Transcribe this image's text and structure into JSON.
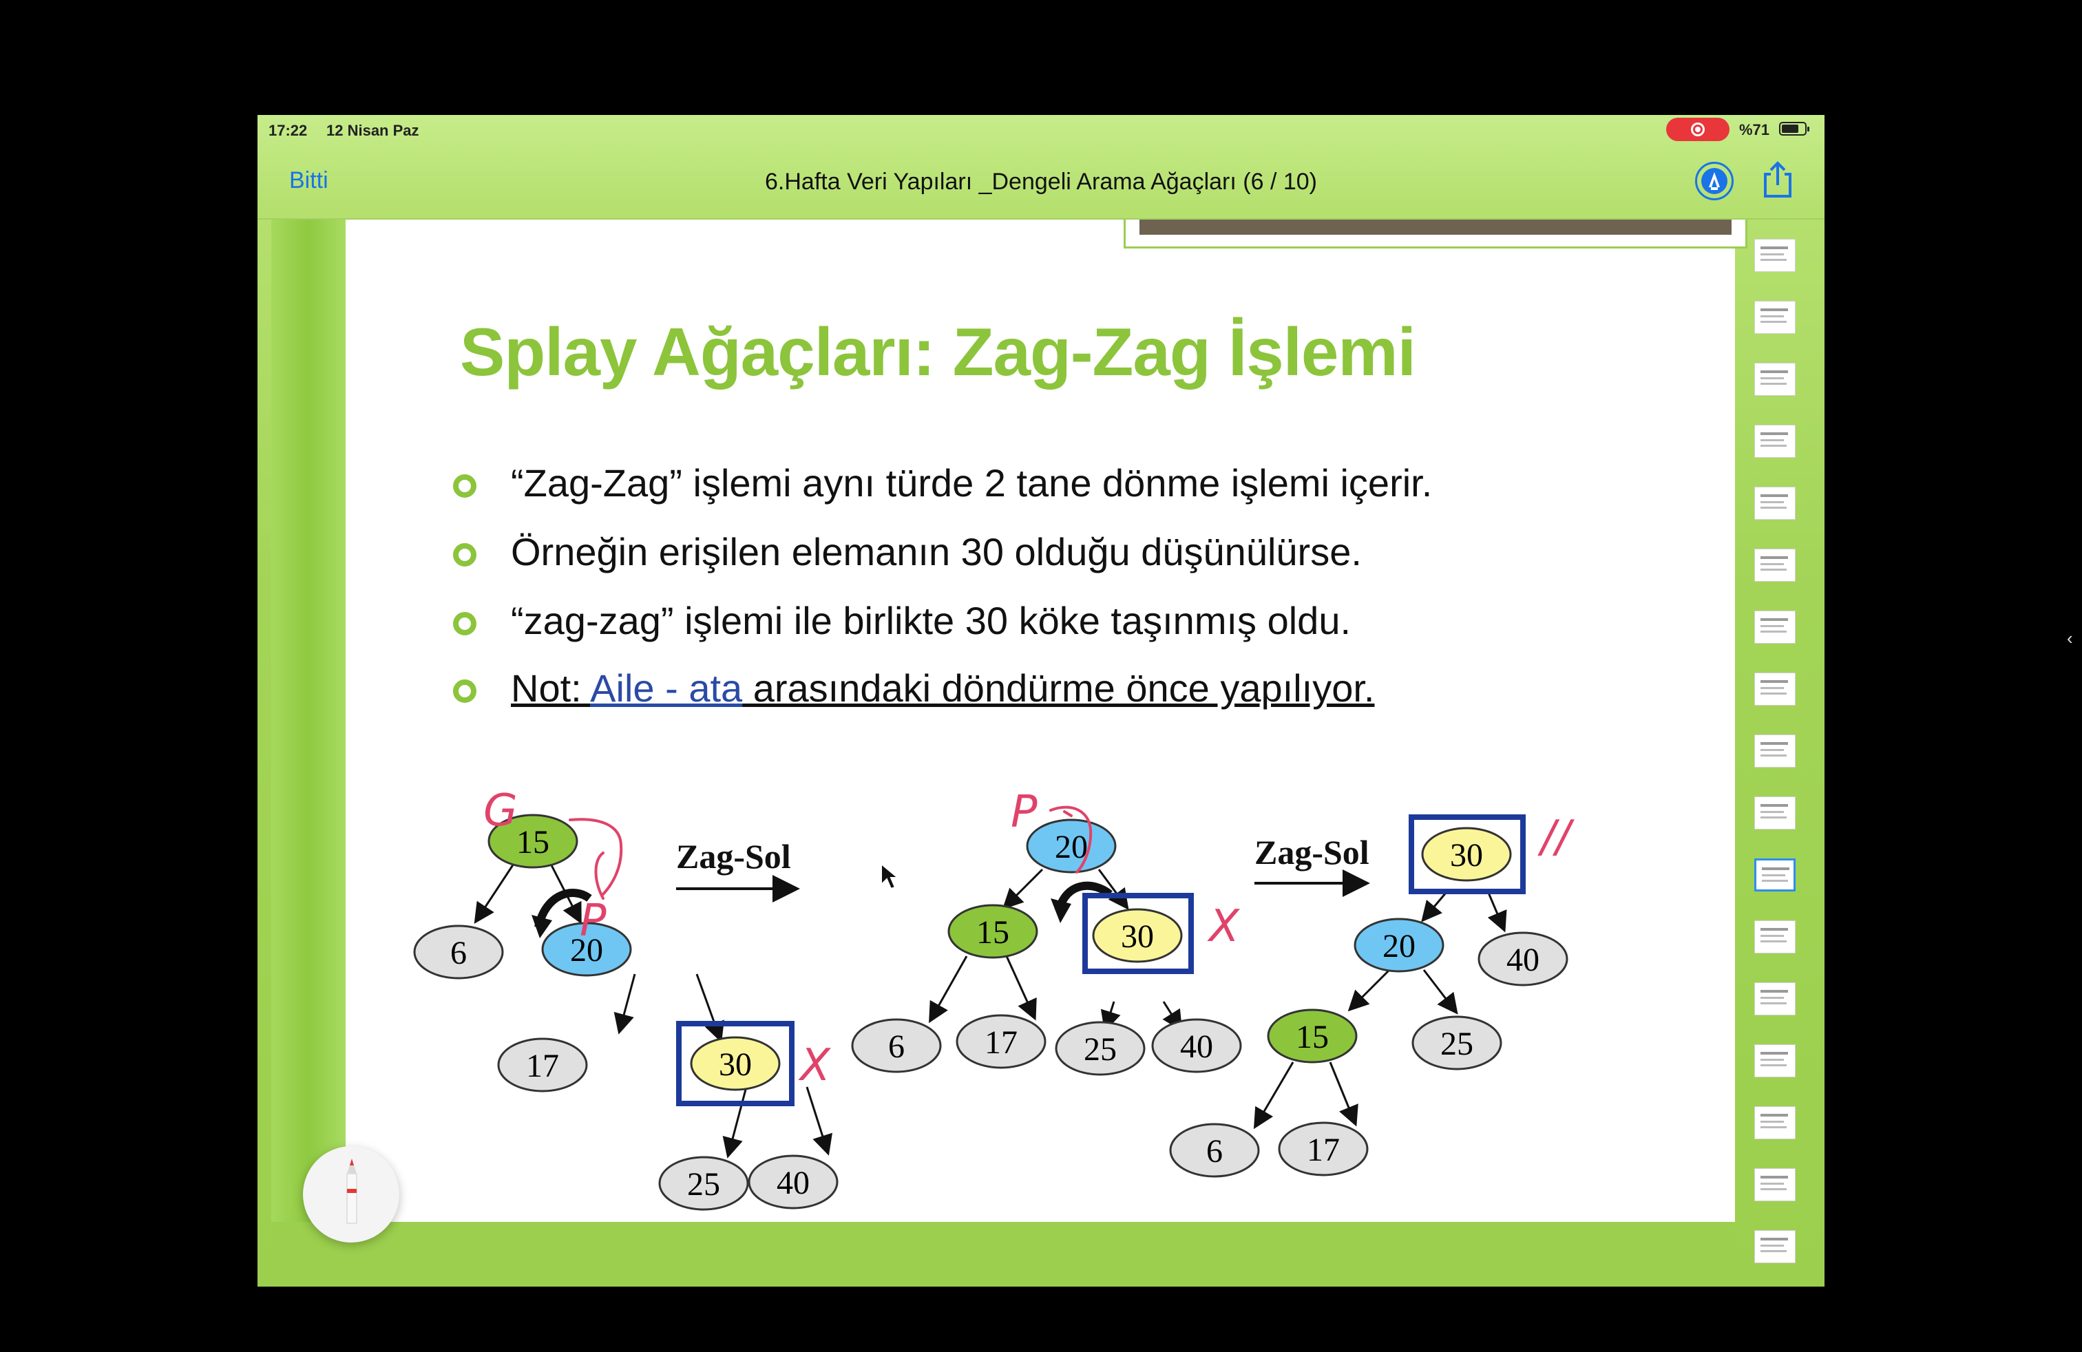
{
  "status": {
    "time": "17:22",
    "date": "12 Nisan Paz",
    "battery": "%71",
    "battery_level": 0.71
  },
  "nav": {
    "done_label": "Bitti",
    "title": "6.Hafta Veri Yapıları _Dengeli Arama Ağaçları (6 / 10)",
    "markup_icon": "markup-pen-icon",
    "share_icon": "share-icon"
  },
  "slide": {
    "title": "Splay Ağaçları: Zag-Zag İşlemi",
    "bullets": [
      "“Zag-Zag” işlemi aynı türde 2 tane dönme işlemi içerir.",
      "Örneğin erişilen elemanın 30 olduğu düşünülürse.",
      "“zag-zag” işlemi ile birlikte 30 köke taşınmış oldu."
    ],
    "note": {
      "prefix": "Not: ",
      "link": "Aile - ata",
      "suffix": " arasındaki döndürme önce yapılıyor."
    },
    "arrow_labels": [
      "Zag-Sol",
      "Zag-Sol"
    ],
    "tree1": {
      "nodes": [
        "15",
        "6",
        "20",
        "17",
        "30",
        "25",
        "40"
      ]
    },
    "tree2": {
      "nodes": [
        "20",
        "15",
        "30",
        "6",
        "17",
        "25",
        "40"
      ]
    },
    "tree3": {
      "nodes": [
        "30",
        "20",
        "40",
        "15",
        "25",
        "6",
        "17"
      ]
    },
    "annotations": [
      "G",
      "P",
      "X",
      "P",
      "X",
      "//"
    ]
  },
  "colors": {
    "green_node": "#8cc43c",
    "blue_node": "#6fc6f2",
    "yellow_node": "#fbf59a",
    "gray_node": "#e0e0e0",
    "frame_blue": "#1d3a9a",
    "annotation_red": "#e0436a"
  },
  "thumbnails": {
    "count": 17,
    "current_index": 10
  }
}
